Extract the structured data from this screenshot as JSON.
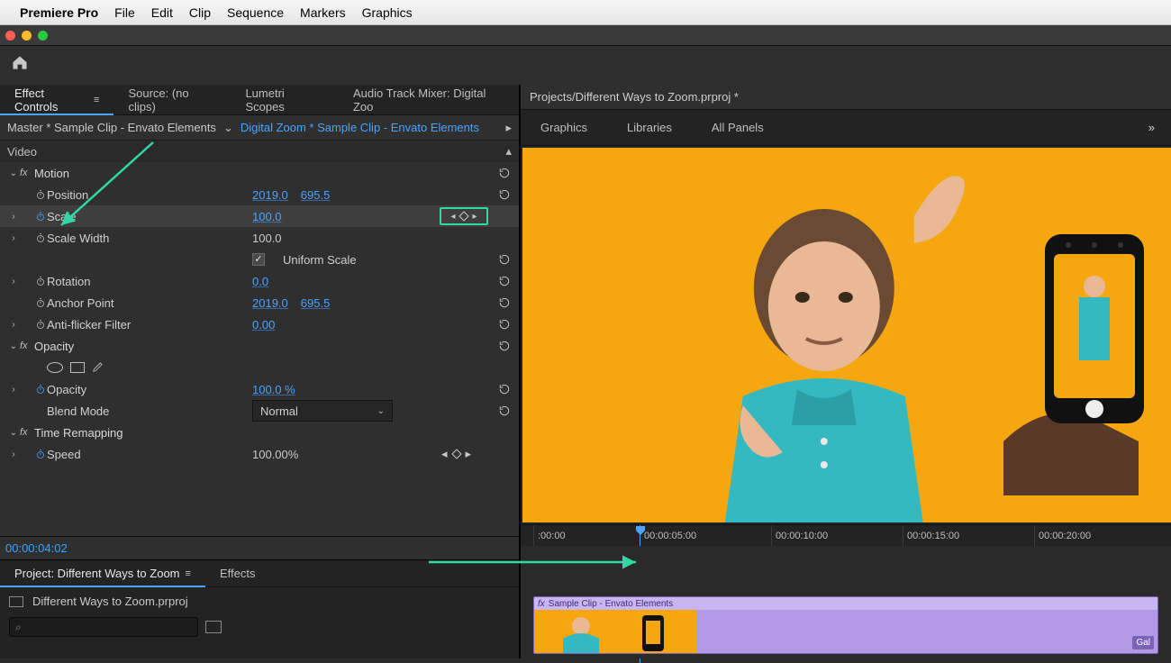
{
  "menubar": {
    "app": "Premiere Pro",
    "items": [
      "File",
      "Edit",
      "Clip",
      "Sequence",
      "Markers",
      "Graphics"
    ]
  },
  "titlepath": "Projects/Different Ways to Zoom.prproj *",
  "rightTabs": [
    "Graphics",
    "Libraries",
    "All Panels"
  ],
  "panelTabs": {
    "effectControls": "Effect Controls",
    "source": "Source: (no clips)",
    "lumetri": "Lumetri Scopes",
    "audioMixer": "Audio Track Mixer: Digital Zoo"
  },
  "breadcrumb": {
    "master": "Master * Sample Clip - Envato Elements",
    "sequence": "Digital Zoom * Sample Clip - Envato Elements"
  },
  "sections": {
    "videoHeader": "Video",
    "motion": "Motion",
    "opacity": "Opacity",
    "timeRemap": "Time Remapping"
  },
  "props": {
    "position": {
      "label": "Position",
      "x": "2019.0",
      "y": "695.5"
    },
    "scale": {
      "label": "Scale",
      "value": "100.0"
    },
    "scaleWidth": {
      "label": "Scale Width",
      "value": "100.0"
    },
    "uniform": {
      "label": "Uniform Scale"
    },
    "rotation": {
      "label": "Rotation",
      "value": "0.0"
    },
    "anchor": {
      "label": "Anchor Point",
      "x": "2019.0",
      "y": "695.5"
    },
    "flicker": {
      "label": "Anti-flicker Filter",
      "value": "0.00"
    },
    "opacity": {
      "label": "Opacity",
      "value": "100.0 %"
    },
    "blend": {
      "label": "Blend Mode",
      "value": "Normal"
    },
    "speed": {
      "label": "Speed",
      "value": "100.00%"
    }
  },
  "timecode": "00:00:04:02",
  "projectPanel": {
    "tab": "Project: Different Ways to Zoom",
    "effectsTab": "Effects",
    "filename": "Different Ways to Zoom.prproj",
    "searchPlaceholder": "Search"
  },
  "timeline": {
    "ticks": [
      ":00:00",
      "00:00:05:00",
      "00:00:10:00",
      "00:00:15:00",
      "00:00:20:00"
    ],
    "clipName": "Sample Clip - Envato Elements",
    "badge": "Gal"
  }
}
